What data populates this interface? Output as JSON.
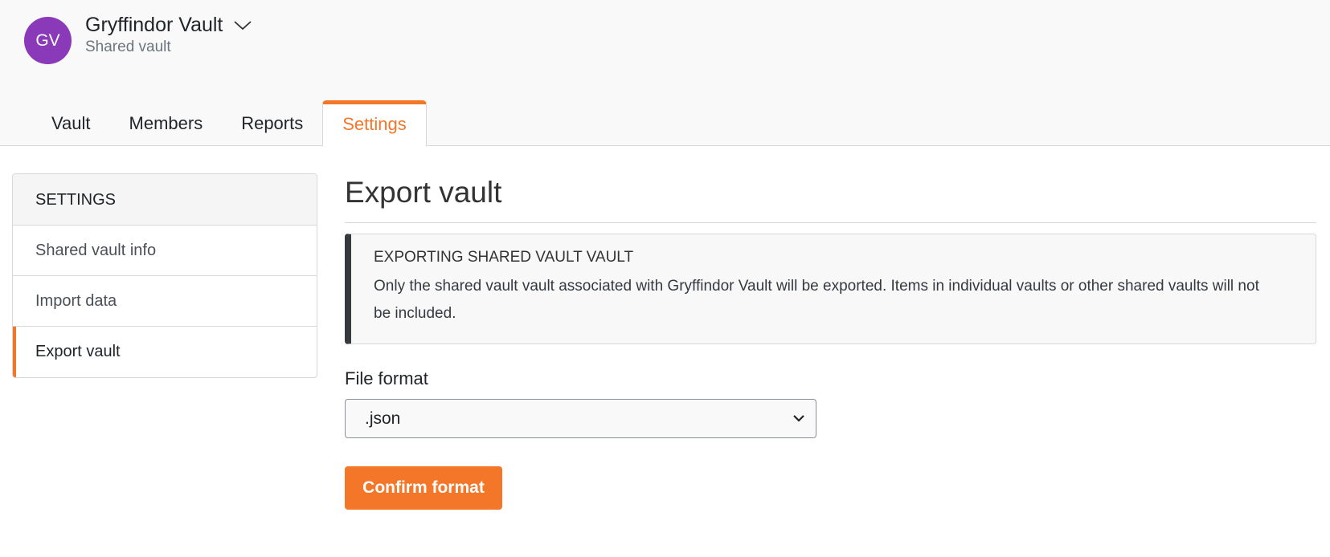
{
  "header": {
    "avatar_initials": "GV",
    "avatar_color": "#8a3ab9",
    "vault_name": "Gryffindor Vault",
    "vault_type": "Shared vault",
    "dropdown_icon": "chevron-down-icon"
  },
  "tabs": [
    {
      "label": "Vault",
      "active": false
    },
    {
      "label": "Members",
      "active": false
    },
    {
      "label": "Reports",
      "active": false
    },
    {
      "label": "Settings",
      "active": true
    }
  ],
  "sidebar": {
    "heading": "SETTINGS",
    "items": [
      {
        "label": "Shared vault info",
        "active": false
      },
      {
        "label": "Import data",
        "active": false
      },
      {
        "label": "Export vault",
        "active": true
      }
    ]
  },
  "main": {
    "title": "Export vault",
    "callout": {
      "title": "EXPORTING SHARED VAULT VAULT",
      "body": "Only the shared vault vault associated with Gryffindor Vault will be exported. Items in individual vaults or other shared vaults will not be included."
    },
    "file_format_label": "File format",
    "file_format_value": ".json",
    "confirm_label": "Confirm format"
  },
  "colors": {
    "accent": "#f47629",
    "callout_border": "#363a3f"
  }
}
